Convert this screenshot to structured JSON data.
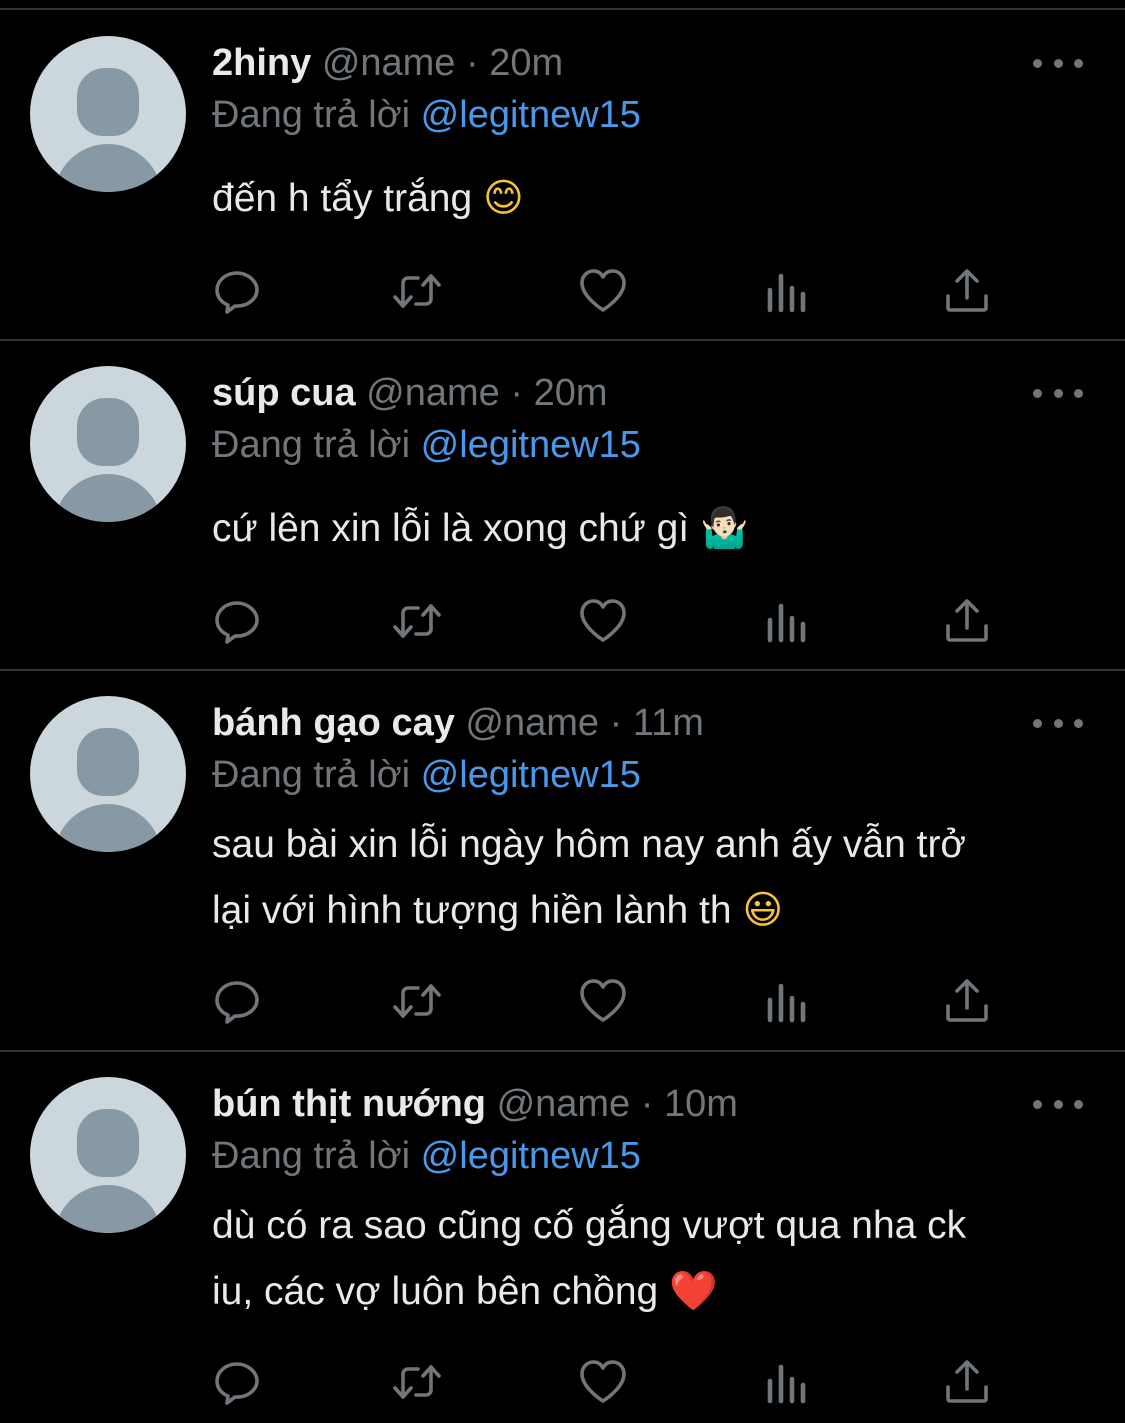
{
  "reply_prefix": "Đang trả lời",
  "tweets": [
    {
      "display_name": "2hiny",
      "handle": "@name",
      "separator": "·",
      "time": "20m",
      "reply_to": "@legitnew15",
      "text": "đến h tẩy trắng",
      "emoji": "😊"
    },
    {
      "display_name": "súp cua",
      "handle": "@name",
      "separator": "·",
      "time": "20m",
      "reply_to": "@legitnew15",
      "text": "cứ lên xin lỗi là xong chứ gì",
      "emoji": "🤷🏻‍♂️"
    },
    {
      "display_name": "bánh gạo cay",
      "handle": "@name",
      "separator": "·",
      "time": "11m",
      "reply_to": "@legitnew15",
      "text": "sau bài xin lỗi ngày hôm nay anh ấy vẫn trở\nlại với hình tượng hiền lành th",
      "emoji": "😃"
    },
    {
      "display_name": "bún thịt nướng",
      "handle": "@name",
      "separator": "·",
      "time": "10m",
      "reply_to": "@legitnew15",
      "text": "dù có ra sao cũng cố gắng vượt qua nha ck\niu, các vợ luôn bên chồng",
      "emoji": "❤️"
    }
  ],
  "icons": {
    "reply": "reply-icon",
    "retweet": "retweet-icon",
    "like": "heart-icon",
    "views": "views-icon",
    "share": "share-icon",
    "more": "more-icon",
    "avatar": "default-avatar-icon"
  },
  "colors": {
    "background": "#000000",
    "primary_text": "#e7e9ea",
    "secondary_text": "#71767b",
    "mention": "#4a99e9",
    "divider": "#2f3336",
    "avatar_bg": "#ccd6dd",
    "avatar_fg": "#8899a6"
  }
}
